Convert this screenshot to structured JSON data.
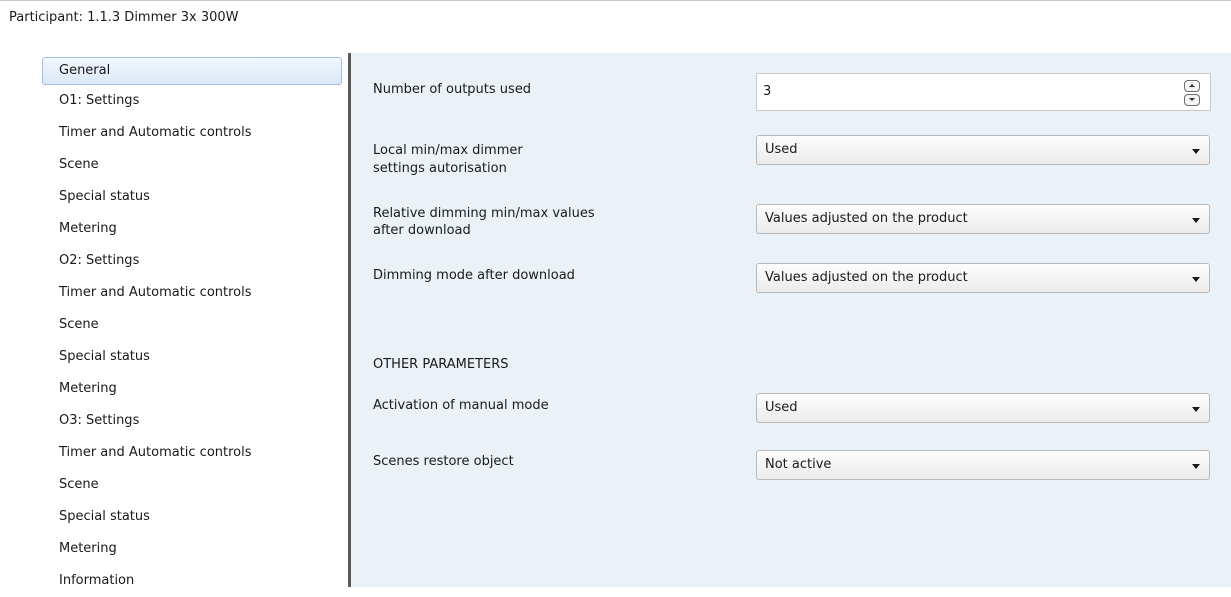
{
  "window": {
    "title": "Participant: 1.1.3  Dimmer 3x 300W"
  },
  "nav": {
    "items": [
      "General",
      "O1: Settings",
      "Timer and Automatic controls",
      "Scene",
      "Special status",
      "Metering",
      "O2: Settings",
      "Timer and Automatic controls",
      "Scene",
      "Special status",
      "Metering",
      "O3: Settings",
      "Timer and Automatic controls",
      "Scene",
      "Special status",
      "Metering",
      "Information"
    ],
    "selected": "General"
  },
  "params": {
    "outputs_label": "Number of outputs used",
    "outputs_value": "3",
    "local_label_1": "Local min/max dimmer",
    "local_label_2": "settings autorisation",
    "local_value": "Used",
    "relative_label_1": "Relative dimming min/max values",
    "relative_label_2": "after download",
    "relative_value": "Values adjusted on the product",
    "dimming_mode_label": "Dimming mode after download",
    "dimming_mode_value": "Values adjusted on the product",
    "other_header": "OTHER PARAMETERS",
    "manual_label": "Activation of manual mode",
    "manual_value": "Used",
    "scenes_label": "Scenes restore object",
    "scenes_value": "Not active"
  },
  "icons": {
    "spin_up": "chevron-up-icon",
    "spin_down": "chevron-down-icon",
    "dropdown_arrow": "dropdown-arrow-icon"
  }
}
